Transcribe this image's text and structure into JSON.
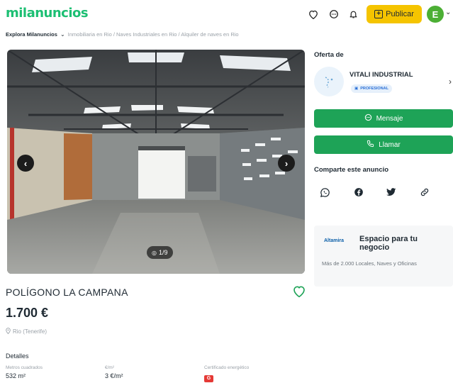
{
  "header": {
    "logo_text": "milanuncios",
    "publish_label": "Publicar",
    "avatar_initial": "E",
    "brand_color": "#1cbf73",
    "publish_color": "#f5c400"
  },
  "breadcrumb": {
    "explore_label": "Explora Milanuncios",
    "path": "Inmobiliaria en Rio / Naves Industriales en Rio / Alquiler de naves en Rio"
  },
  "gallery": {
    "counter_text": "1/9",
    "current_image": 1,
    "total_images": 9
  },
  "listing": {
    "title": "POLÍGONO LA CAMPANA",
    "price": "1.700 €",
    "location": "Rio (Tenerife)",
    "details_heading": "Detalles",
    "specs": [
      {
        "label": "Metros cuadrados",
        "value": "532 m²"
      },
      {
        "label": "€/m²",
        "value": "3 €/m²"
      },
      {
        "label": "Certificado energético",
        "value": "G"
      }
    ]
  },
  "sidebar": {
    "offer_heading": "Oferta de",
    "seller_name": "VITALI INDUSTRIAL",
    "seller_badge": "PROFESIONAL",
    "message_label": "Mensaje",
    "call_label": "Llamar",
    "share_heading": "Comparte este anuncio",
    "share_icons": [
      "whatsapp-icon",
      "facebook-icon",
      "twitter-icon",
      "link-icon"
    ],
    "action_color": "#1ea357"
  },
  "ad": {
    "logo_text": "Altamira",
    "headline": "Espacio para tu negocio",
    "body": "Más de 2.000 Locales, Naves y Oficinas"
  }
}
